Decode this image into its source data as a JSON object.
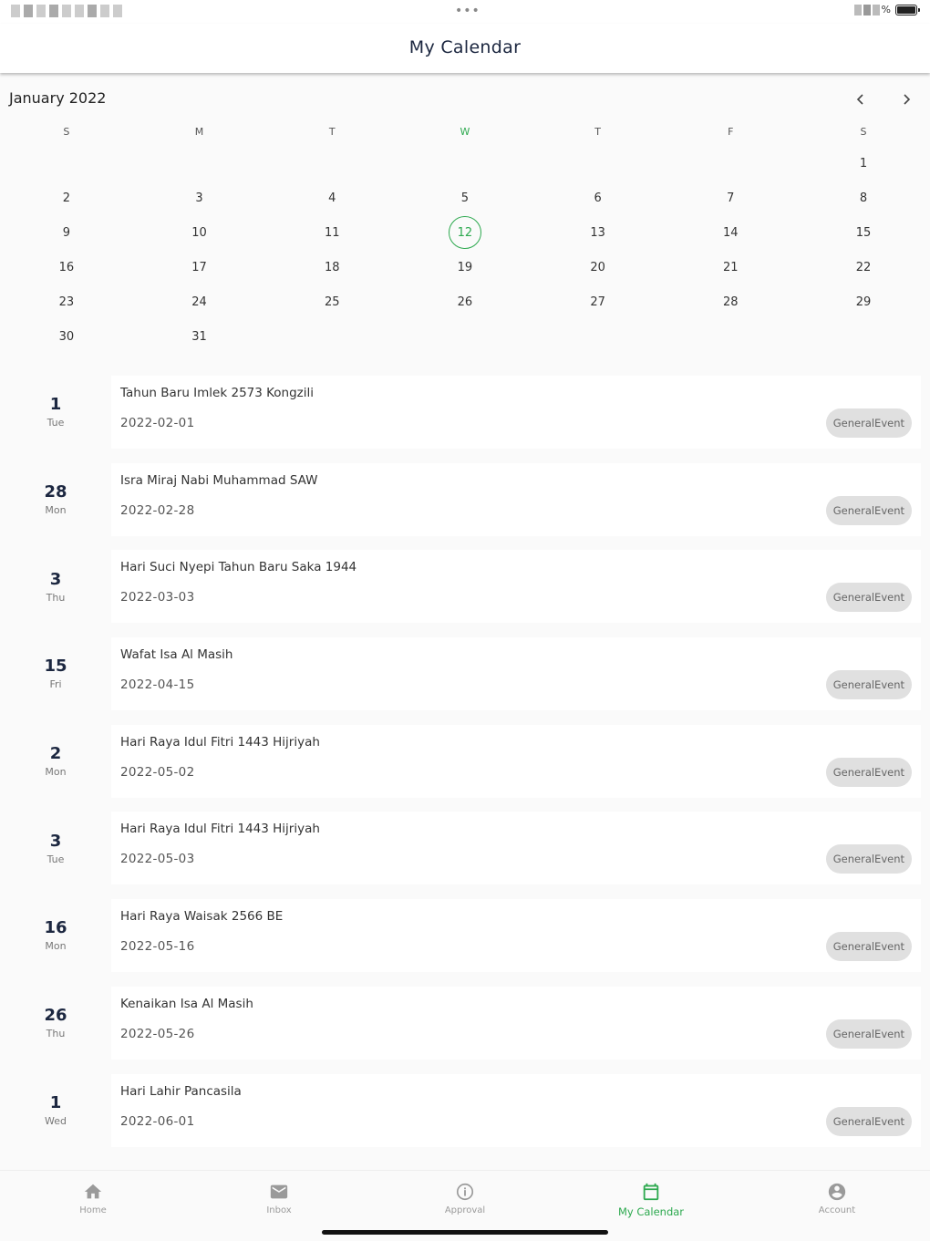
{
  "header": {
    "title": "My Calendar"
  },
  "status_bar": {
    "battery_text": "%"
  },
  "calendar": {
    "month_label": "January 2022",
    "prev_icon": "chevron-left-icon",
    "next_icon": "chevron-right-icon",
    "weekdays": [
      "S",
      "M",
      "T",
      "W",
      "T",
      "F",
      "S"
    ],
    "weeks": [
      [
        "",
        "",
        "",
        "",
        "",
        "",
        "1"
      ],
      [
        "2",
        "3",
        "4",
        "5",
        "6",
        "7",
        "8"
      ],
      [
        "9",
        "10",
        "11",
        "12",
        "13",
        "14",
        "15"
      ],
      [
        "16",
        "17",
        "18",
        "19",
        "20",
        "21",
        "22"
      ],
      [
        "23",
        "24",
        "25",
        "26",
        "27",
        "28",
        "29"
      ],
      [
        "30",
        "31",
        "",
        "",
        "",
        "",
        ""
      ]
    ],
    "today": "12",
    "accent_color": "#2da94f"
  },
  "events": [
    {
      "day": "1",
      "weekday": "Tue",
      "title": "Tahun Baru Imlek 2573 Kongzili",
      "date": "2022-02-01",
      "type": "GeneralEvent"
    },
    {
      "day": "28",
      "weekday": "Mon",
      "title": "Isra Miraj Nabi Muhammad SAW",
      "date": "2022-02-28",
      "type": "GeneralEvent"
    },
    {
      "day": "3",
      "weekday": "Thu",
      "title": "Hari Suci Nyepi Tahun Baru Saka 1944",
      "date": "2022-03-03",
      "type": "GeneralEvent"
    },
    {
      "day": "15",
      "weekday": "Fri",
      "title": "Wafat Isa Al Masih",
      "date": "2022-04-15",
      "type": "GeneralEvent"
    },
    {
      "day": "2",
      "weekday": "Mon",
      "title": "Hari Raya Idul Fitri 1443 Hijriyah",
      "date": "2022-05-02",
      "type": "GeneralEvent"
    },
    {
      "day": "3",
      "weekday": "Tue",
      "title": "Hari Raya Idul Fitri 1443 Hijriyah",
      "date": "2022-05-03",
      "type": "GeneralEvent"
    },
    {
      "day": "16",
      "weekday": "Mon",
      "title": "Hari Raya Waisak 2566 BE",
      "date": "2022-05-16",
      "type": "GeneralEvent"
    },
    {
      "day": "26",
      "weekday": "Thu",
      "title": "Kenaikan Isa Al Masih",
      "date": "2022-05-26",
      "type": "GeneralEvent"
    },
    {
      "day": "1",
      "weekday": "Wed",
      "title": "Hari Lahir Pancasila",
      "date": "2022-06-01",
      "type": "GeneralEvent"
    }
  ],
  "bottom_nav": {
    "tabs": [
      {
        "label": "Home",
        "icon": "home-icon",
        "active": false
      },
      {
        "label": "Inbox",
        "icon": "mail-icon",
        "active": false
      },
      {
        "label": "Approval",
        "icon": "info-icon",
        "active": false
      },
      {
        "label": "My Calendar",
        "icon": "calendar-icon",
        "active": true
      },
      {
        "label": "Account",
        "icon": "account-icon",
        "active": false
      }
    ]
  }
}
